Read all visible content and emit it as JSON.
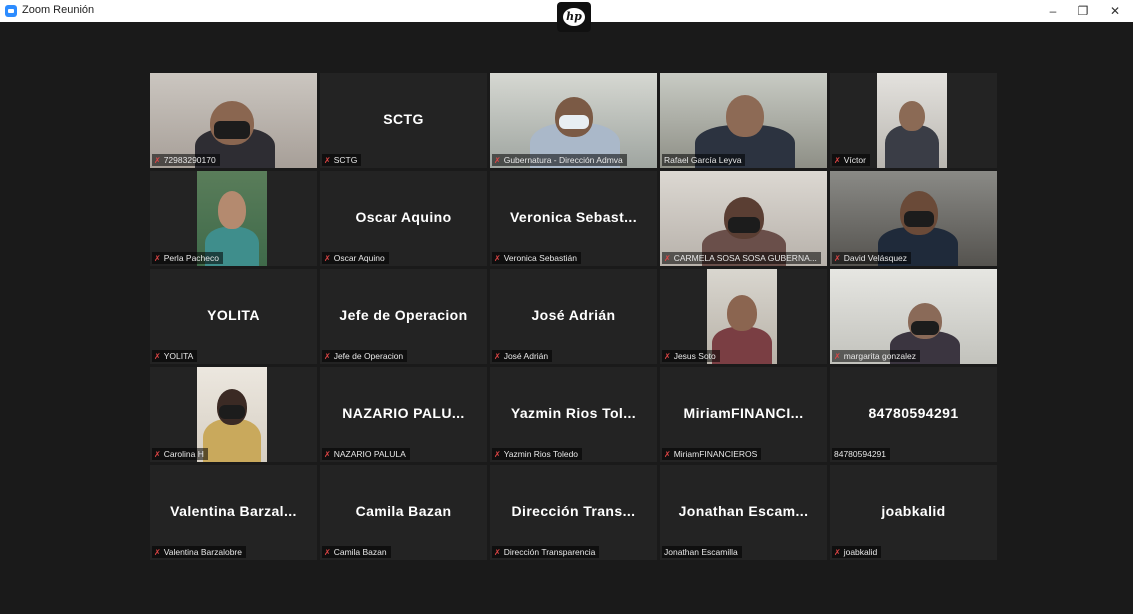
{
  "window": {
    "title": "Zoom Reunión",
    "controls": {
      "minimize": "–",
      "restore": "❐",
      "close": "✕"
    },
    "brand_logo": "hp"
  },
  "colors": {
    "active_speaker": "#b9d94a",
    "muted_mic": "#e04545",
    "tile_bg": "#232323"
  },
  "participants": [
    {
      "name": "72983290170",
      "display": "",
      "muted": true
    },
    {
      "name": "SCTG",
      "display": "SCTG",
      "muted": true
    },
    {
      "name": "Gubernatura - Dirección Admva",
      "display": "",
      "muted": true
    },
    {
      "name": "Rafael García Leyva",
      "display": "",
      "muted": false
    },
    {
      "name": "Víctor",
      "display": "",
      "muted": true
    },
    {
      "name": "Perla Pacheco",
      "display": "",
      "muted": true
    },
    {
      "name": "Oscar Aquino",
      "display": "Oscar Aquino",
      "muted": true
    },
    {
      "name": "Veronica Sebastián",
      "display": "Veronica Sebast...",
      "muted": true
    },
    {
      "name": "CARMELA SOSA SOSA GUBERNA...",
      "display": "",
      "muted": true
    },
    {
      "name": "David Velásquez",
      "display": "",
      "muted": true
    },
    {
      "name": "YOLITA",
      "display": "YOLITA",
      "muted": true
    },
    {
      "name": "Jefe de Operacion",
      "display": "Jefe de Operacion",
      "muted": true
    },
    {
      "name": "José Adrián",
      "display": "José Adrián",
      "muted": true
    },
    {
      "name": "Jesus Soto",
      "display": "",
      "muted": true
    },
    {
      "name": "margarita gonzalez",
      "display": "",
      "muted": true
    },
    {
      "name": "Carolina H",
      "display": "",
      "muted": true
    },
    {
      "name": "NAZARIO PALULA",
      "display": "NAZARIO PALU...",
      "muted": true
    },
    {
      "name": "Yazmin Rios Toledo",
      "display": "Yazmin Rios Tol...",
      "muted": true
    },
    {
      "name": "MiriamFINANCIEROS",
      "display": "MiriamFINANCI...",
      "muted": true
    },
    {
      "name": "84780594291",
      "display": "84780594291",
      "muted": false
    },
    {
      "name": "Valentina Barzalobre",
      "display": "Valentina Barzal...",
      "muted": true
    },
    {
      "name": "Camila Bazan",
      "display": "Camila Bazan",
      "muted": true
    },
    {
      "name": "Dirección Transparencia",
      "display": "Dirección Trans...",
      "muted": true
    },
    {
      "name": "Jonathan Escamilla",
      "display": "Jonathan Escam...",
      "muted": false
    },
    {
      "name": "joabkalid",
      "display": "joabkalid",
      "muted": true
    }
  ]
}
